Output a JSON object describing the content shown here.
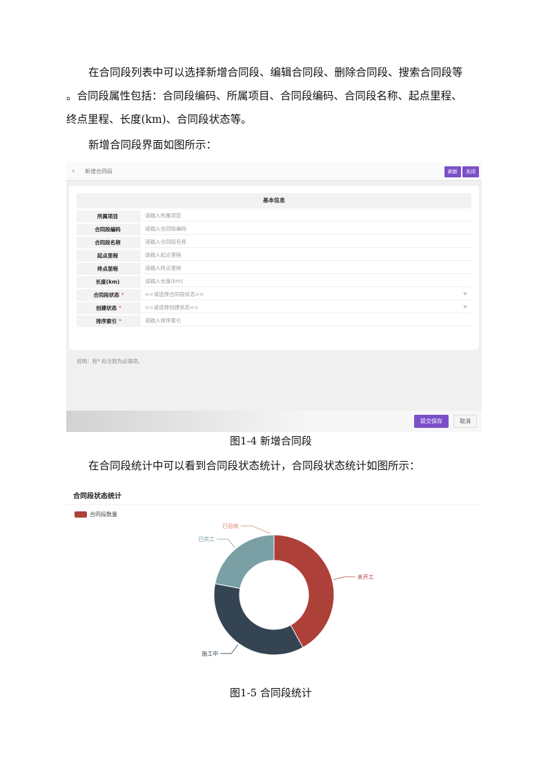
{
  "doc": {
    "para1_line1": "在合同段列表中可以选择新增合同段、编辑合同段、删除合同段、搜索合同段等",
    "para1_line2": "。合同段属性包括：合同段编码、所属项目、合同段编码、合同段名称、起点里程、",
    "para1_line3": "终点里程、长度(km)、合同段状态等。",
    "para2": "新增合同段界面如图所示：",
    "caption1": "图1-4 新增合同段",
    "para3": "在合同段统计中可以看到合同段状态统计，合同段状态统计如图所示：",
    "caption2": "图1-5 合同段统计"
  },
  "form_screen": {
    "page_title": "新增合同段",
    "refresh_label": "刷新",
    "close_label": "关闭",
    "section_title": "基本信息",
    "fields": [
      {
        "label": "所属项目",
        "placeholder": "请输入所属项目",
        "required": "",
        "select": false
      },
      {
        "label": "合同段编码",
        "placeholder": "请输入合同段编码",
        "required": "",
        "select": false
      },
      {
        "label": "合同段名称",
        "placeholder": "请输入合同段名称",
        "required": "",
        "select": false
      },
      {
        "label": "起点里程",
        "placeholder": "请输入起点里程",
        "required": "",
        "select": false
      },
      {
        "label": "终点里程",
        "placeholder": "请输入终点里程",
        "required": "",
        "select": false
      },
      {
        "label": "长度(km)",
        "placeholder": "请输入长度(km)",
        "required": "",
        "select": false
      },
      {
        "label": "合同段状态",
        "placeholder": "==请选择合同段状态==",
        "required": "*",
        "select": true
      },
      {
        "label": "创建状态",
        "placeholder": "==请选择创建状态==",
        "required": "*",
        "select": true
      },
      {
        "label": "排序索引",
        "placeholder": "请输入排序索引",
        "required": "*",
        "select": false
      }
    ],
    "note": "说明：有* 标注则为必填项。",
    "save_label": "提交保存",
    "cancel_label": "取消",
    "accent_color": "#7b4fc9"
  },
  "chart_data": {
    "type": "pie",
    "title": "合同段状态统计",
    "legend": [
      "合同段数量"
    ],
    "legend_placement": "top-left",
    "donut": true,
    "slices": [
      {
        "label": "未开工",
        "value": 42,
        "color": "#ad4038"
      },
      {
        "label": "施工中",
        "value": 36,
        "color": "#344453"
      },
      {
        "label": "已完工",
        "value": 22,
        "color": "#7aa0a6"
      },
      {
        "label": "已验收",
        "value": 0,
        "color": "#d9856c"
      }
    ]
  }
}
